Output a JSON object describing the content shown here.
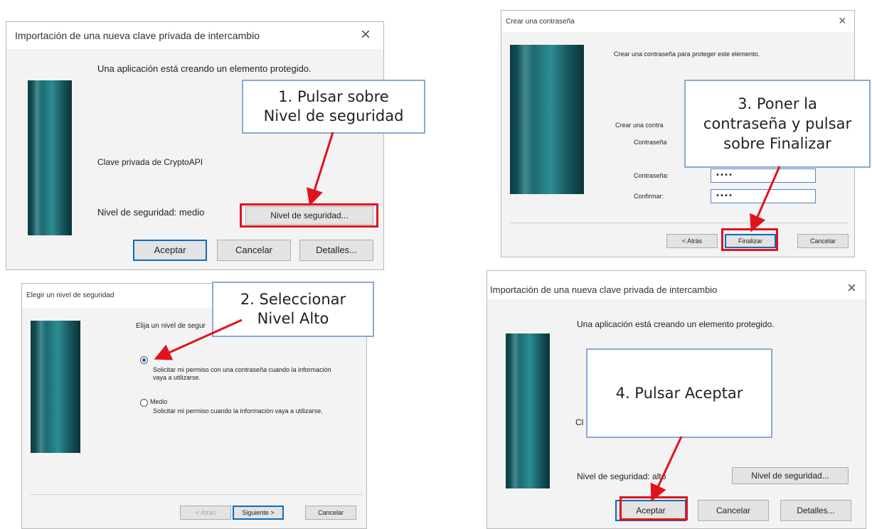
{
  "dialog1": {
    "title": "Importación de una nueva clave privada de intercambio",
    "close": "×",
    "intro": "Una aplicación está creando un elemento protegido.",
    "key_label": "Clave privada de CryptoAPI",
    "level_text": "Nivel de seguridad: medio",
    "level_button": "Nivel de seguridad...",
    "ok_button": "Aceptar",
    "cancel_button": "Cancelar",
    "details_button": "Detalles..."
  },
  "dialog2": {
    "title": "Elegir un nivel de seguridad",
    "intro": "Elija un nivel de segur",
    "high_desc": "Solicitar mi permiso con una contraseña cuando la información vaya a utilizarse.",
    "medium_label": "Medio",
    "medium_desc": "Solicitar mi permiso cuando la información vaya a utilizarse.",
    "back_button": "< Atrás",
    "next_button": "Siguiente >",
    "cancel_button": "Cancelar"
  },
  "dialog3": {
    "title": "Crear una contraseña",
    "close": "×",
    "intro": "Crear una contraseña para proteger este elemento.",
    "create_for": "Crear una contra",
    "password_for": "Contraseña",
    "password_label": "Contraseña:",
    "password_value": "••••",
    "confirm_label": "Confirmar:",
    "confirm_value": "••••",
    "back_button": "< Atrás",
    "finish_button": "Finalizar",
    "cancel_button": "Cancelar"
  },
  "dialog4": {
    "title": "Importación de una nueva clave privada de intercambio",
    "close": "×",
    "intro": "Una aplicación está creando un elemento protegido.",
    "key_label": "Cl",
    "level_text": "Nivel de seguridad: alto",
    "level_button": "Nivel de seguridad...",
    "ok_button": "Aceptar",
    "cancel_button": "Cancelar",
    "details_button": "Detalles..."
  },
  "callouts": {
    "step1": "1. Pulsar sobre\nNivel de seguridad",
    "step2": "2. Seleccionar\nNivel Alto",
    "step3": "3. Poner la\ncontraseña y pulsar\nsobre Finalizar",
    "step4": "4. Pulsar Aceptar"
  },
  "colors": {
    "highlight": "#e0131d",
    "callout_border": "#8aa9d2",
    "default_button_border": "#0a6dbd"
  }
}
